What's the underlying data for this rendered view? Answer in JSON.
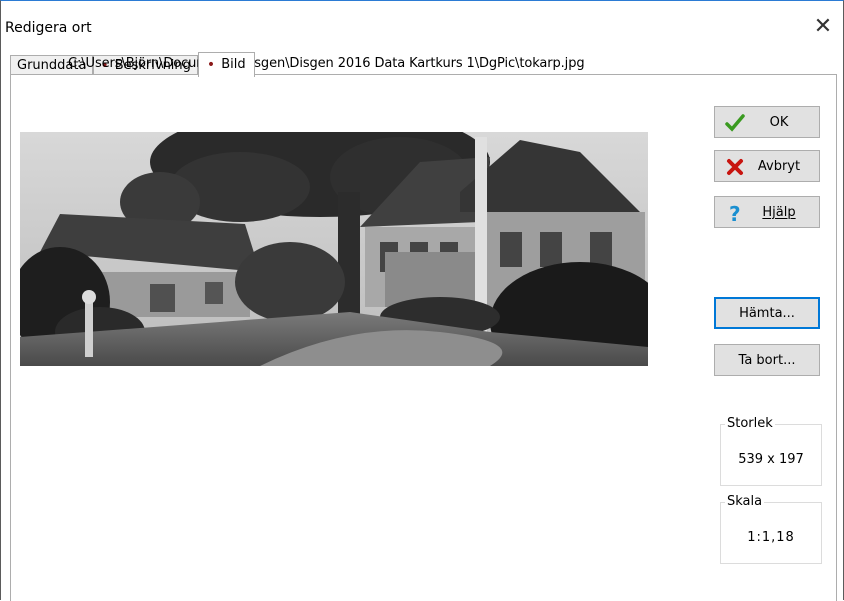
{
  "window": {
    "title": "Redigera ort",
    "close_icon": "close-icon"
  },
  "tabs": [
    {
      "label": "Grunddata",
      "dot": false
    },
    {
      "label": "Beskrivning",
      "dot": true
    },
    {
      "label": "Bild",
      "dot": true,
      "active": true
    }
  ],
  "image": {
    "path": "C:\\Users\\Björn\\Documents\\Disgen\\Disgen 2016 Data Kartkurs 1\\DgPic\\tokarp.jpg",
    "description_icon": "photo-image"
  },
  "buttons": {
    "ok": "OK",
    "cancel": "Avbryt",
    "help": "Hjälp",
    "fetch": "Hämta...",
    "remove": "Ta bort..."
  },
  "size": {
    "label": "Storlek",
    "value": "539 x 197"
  },
  "scale": {
    "label": "Skala",
    "value": "1:1,18"
  },
  "colors": {
    "ok_check": "#3a9a20",
    "cancel_x": "#c8140f",
    "help_q": "#1a8fd0",
    "focus": "#0078d7",
    "tab_dot": "#8b1a1a"
  }
}
